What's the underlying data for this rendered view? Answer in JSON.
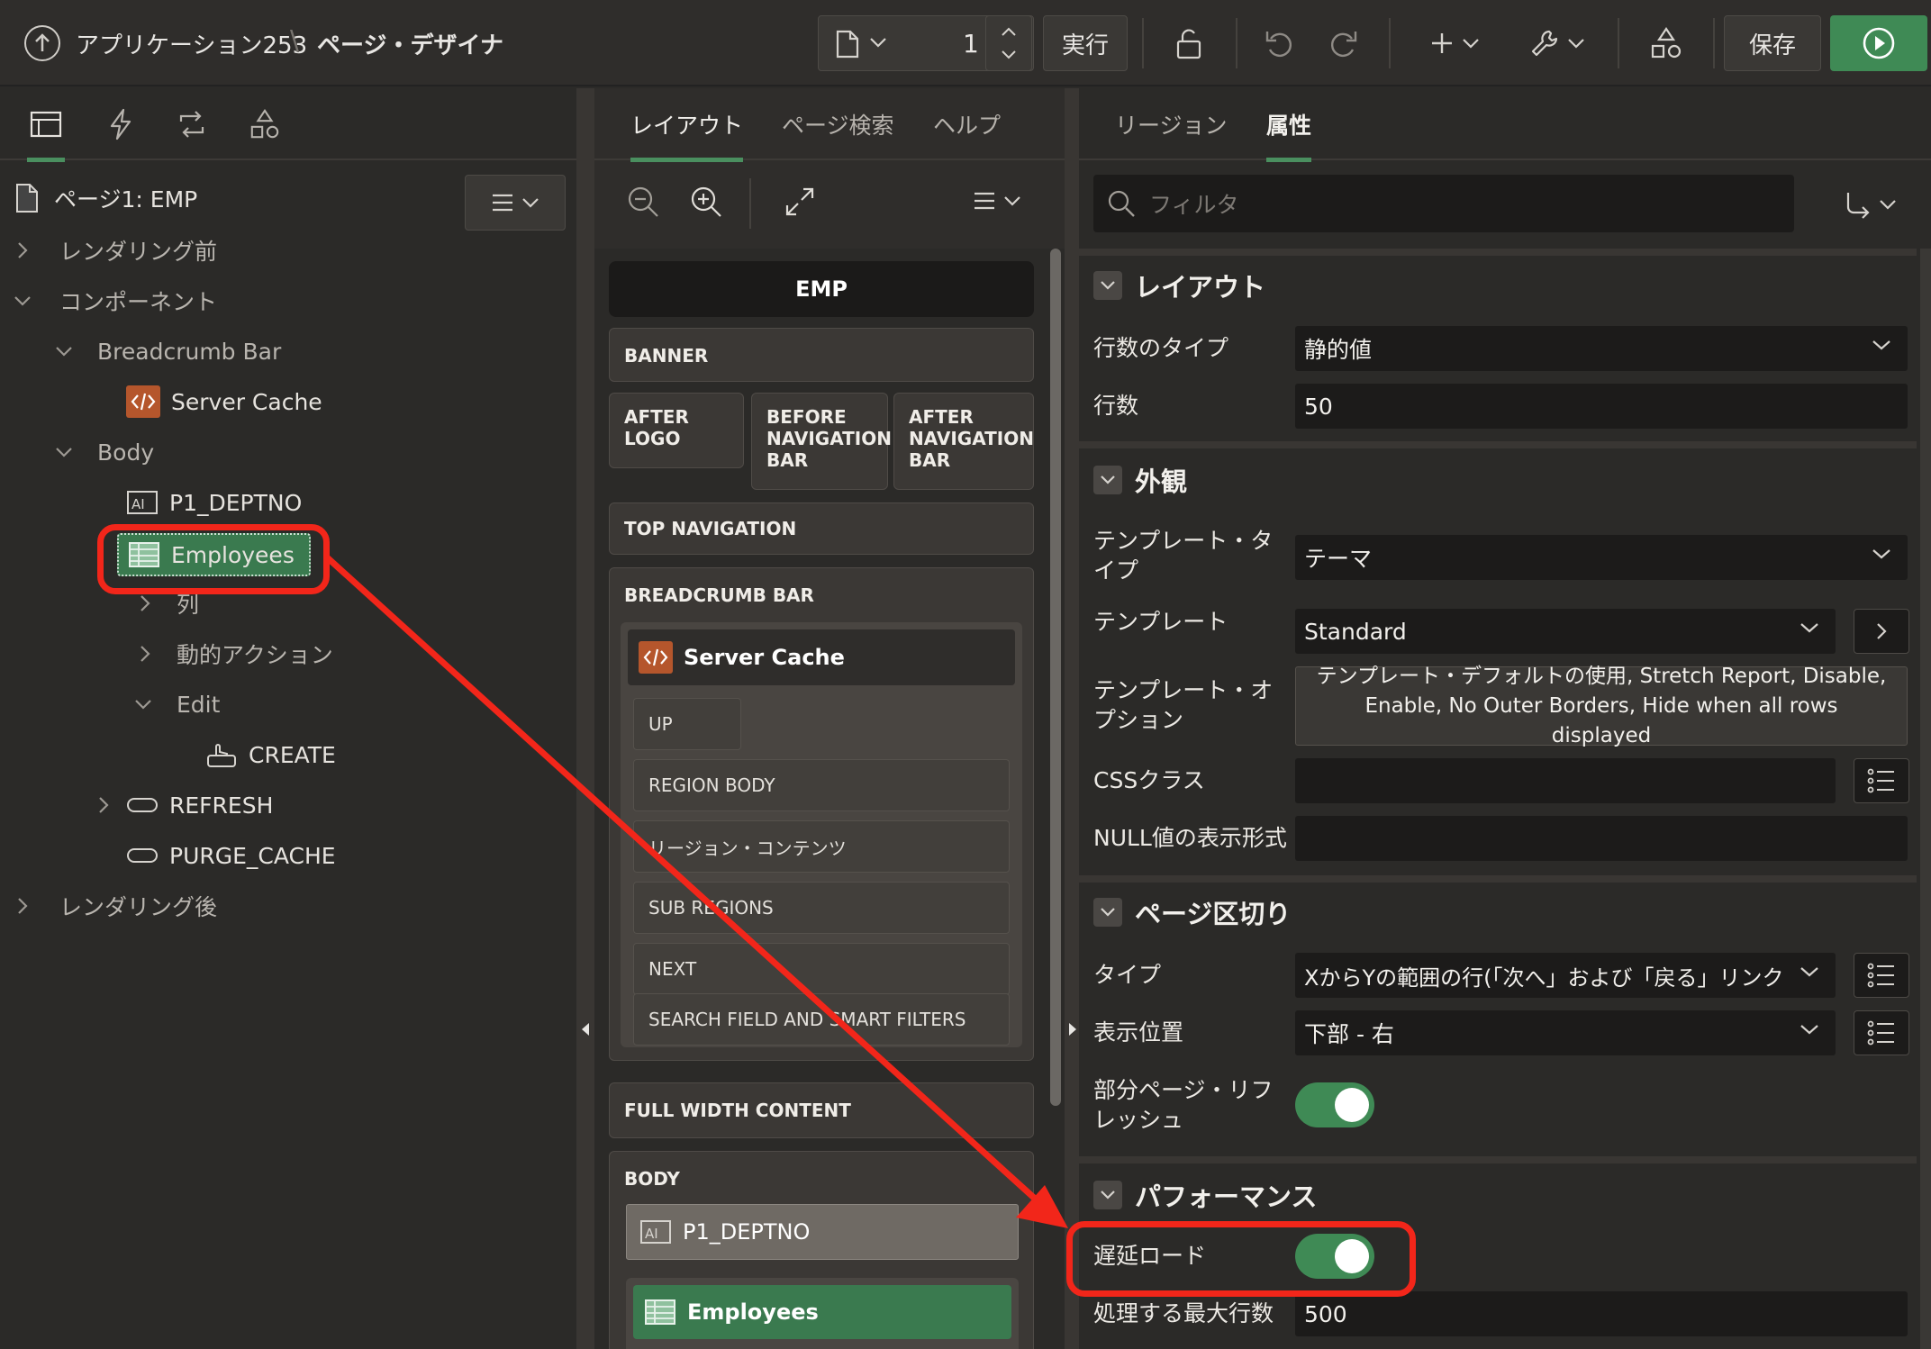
{
  "header": {
    "app_title": "アプリケーション253",
    "separator": "\\",
    "page_designer": "ページ・デザイナ",
    "page_number": "1",
    "run_label": "実行",
    "save_label": "保存"
  },
  "left": {
    "page_title": "ページ1: EMP",
    "tree": {
      "pre_rendering": "レンダリング前",
      "components": "コンポーネント",
      "breadcrumb_bar": "Breadcrumb Bar",
      "server_cache": "Server Cache",
      "body": "Body",
      "p1_deptno": "P1_DEPTNO",
      "employees": "Employees",
      "columns": "列",
      "dynamic_actions": "動的アクション",
      "edit": "Edit",
      "create": "CREATE",
      "refresh": "REFRESH",
      "purge_cache": "PURGE_CACHE",
      "post_rendering": "レンダリング後"
    }
  },
  "mid": {
    "tabs": [
      "レイアウト",
      "ページ検索",
      "ヘルプ"
    ],
    "emp_title": "EMP",
    "banner": "BANNER",
    "after_logo": "AFTER LOGO",
    "before_nav": "BEFORE NAVIGATION BAR",
    "after_nav": "AFTER NAVIGATION BAR",
    "top_navigation": "TOP NAVIGATION",
    "breadcrumb_bar": "BREADCRUMB BAR",
    "server_cache": "Server Cache",
    "up": "UP",
    "region_body": "REGION BODY",
    "region_contents": "リージョン・コンテンツ",
    "sub_regions": "SUB REGIONS",
    "next": "NEXT",
    "search_field": "SEARCH FIELD AND SMART FILTERS",
    "full_width": "FULL WIDTH CONTENT",
    "body": "BODY",
    "p1_deptno": "P1_DEPTNO",
    "employees": "Employees"
  },
  "right": {
    "tabs": [
      "リージョン",
      "属性"
    ],
    "filter_placeholder": "フィルタ",
    "sections": {
      "layout": "レイアウト",
      "appearance": "外観",
      "pagination": "ページ区切り",
      "performance": "パフォーマンス"
    },
    "props": {
      "rows_type_label": "行数のタイプ",
      "rows_type_value": "静的値",
      "rows_label": "行数",
      "rows_value": "50",
      "template_type_label": "テンプレート・タイプ",
      "template_type_value": "テーマ",
      "template_label": "テンプレート",
      "template_value": "Standard",
      "template_options_label": "テンプレート・オプション",
      "template_options_value": "テンプレート・デフォルトの使用, Stretch Report, Disable, Enable, No Outer Borders, Hide when all rows displayed",
      "css_label": "CSSクラス",
      "null_label": "NULL値の表示形式",
      "type_label": "タイプ",
      "type_value": "XからYの範囲の行(「次へ」および「戻る」リンク",
      "position_label": "表示位置",
      "position_value": "下部 - 右",
      "partial_refresh_label": "部分ページ・リフレッシュ",
      "lazy_load_label": "遅延ロード",
      "max_rows_label": "処理する最大行数",
      "max_rows_value": "500"
    }
  },
  "colors": {
    "accent_green": "#3f8a55",
    "highlight_red": "#f2261a"
  }
}
